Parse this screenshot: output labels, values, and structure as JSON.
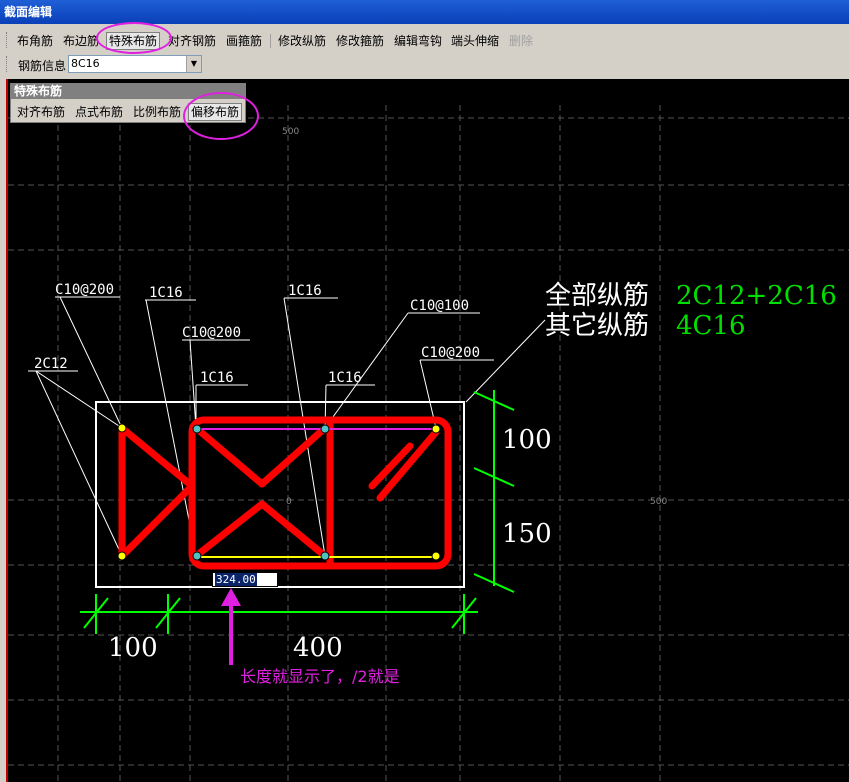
{
  "window": {
    "title": "截面编辑"
  },
  "toolbar": {
    "items": [
      {
        "label": "布角筋",
        "state": "normal"
      },
      {
        "label": "布边筋",
        "state": "normal"
      },
      {
        "label": "特殊布筋",
        "state": "pressed"
      },
      {
        "label": "对齐钢筋",
        "state": "normal"
      },
      {
        "label": "画箍筋",
        "state": "normal"
      },
      {
        "label": "修改纵筋",
        "state": "normal"
      },
      {
        "label": "修改箍筋",
        "state": "normal"
      },
      {
        "label": "编辑弯钩",
        "state": "normal"
      },
      {
        "label": "端头伸缩",
        "state": "normal"
      },
      {
        "label": "删除",
        "state": "disabled"
      }
    ]
  },
  "rebar_info": {
    "label": "钢筋信息",
    "value": "8C16"
  },
  "special_panel": {
    "title": "特殊布筋",
    "buttons": [
      {
        "label": "对齐布筋",
        "state": "normal"
      },
      {
        "label": "点式布筋",
        "state": "normal"
      },
      {
        "label": "比例布筋",
        "state": "normal"
      },
      {
        "label": "偏移布筋",
        "state": "pressed"
      }
    ]
  },
  "canvas": {
    "axis_labels": {
      "top": "500",
      "center": "0",
      "right": "500"
    },
    "annotations": {
      "a1": "C10@200",
      "a2": "1C16",
      "a3": "C10@200",
      "a4": "1C16",
      "a5": "1C16",
      "a6": "C10@100",
      "a7": "C10@200",
      "a8": "1C16",
      "a9": "2C12"
    },
    "summary": {
      "all_label": "全部纵筋",
      "all_value": "2C12+2C16",
      "other_label": "其它纵筋",
      "other_value": "4C16"
    },
    "dimensions": {
      "right_top": "100",
      "right_bottom": "150",
      "bottom_left": "100",
      "bottom_right": "400"
    },
    "length_input": "324.00",
    "note": "长度就显示了，/2就是"
  },
  "colors": {
    "rebar": "#ff0000",
    "dimension": "#00ff00",
    "highlight": "#e020e0",
    "summary_value": "#00e000"
  }
}
